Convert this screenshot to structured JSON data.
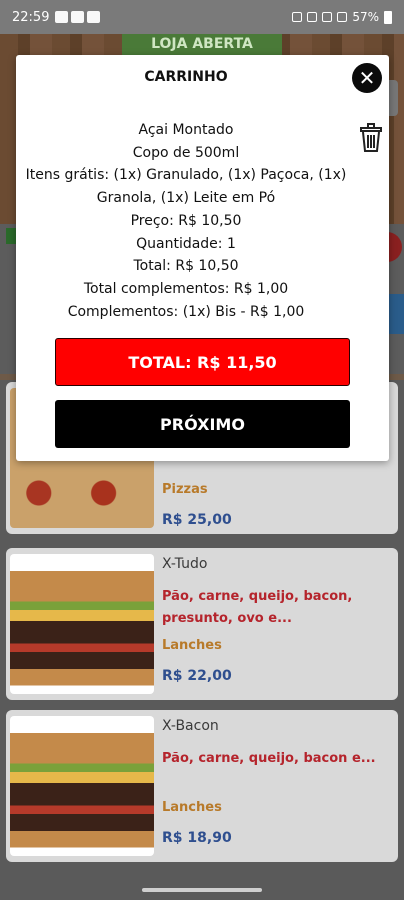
{
  "status_bar": {
    "time": "22:59",
    "battery": "57%"
  },
  "store": {
    "status_label": "LOJA ABERTA"
  },
  "cart": {
    "title": "CARRINHO",
    "close_icon": "close-icon",
    "trash_icon": "trash-icon",
    "item_name": "Açai Montado",
    "item_size": "Copo de 500ml",
    "free_items_line1": "Itens grátis: (1x) Granulado, (1x) Paçoca, (1x)",
    "free_items_line2": "Granola, (1x) Leite em Pó",
    "price": "Preço: R$ 10,50",
    "quantity": "Quantidade: 1",
    "total": "Total: R$ 10,50",
    "total_complements": "Total complementos: R$ 1,00",
    "complements": "Complementos: (1x) Bis - R$ 1,00",
    "total_button": "TOTAL: R$ 11,50",
    "next_button": "PRÓXIMO"
  },
  "products": [
    {
      "name": "",
      "description": "",
      "category": "Pizzas",
      "price": "R$ 25,00"
    },
    {
      "name": "X-Tudo",
      "description": "Pão, carne, queijo, bacon, presunto, ovo e...",
      "category": "Lanches",
      "price": "R$ 22,00"
    },
    {
      "name": "X-Bacon",
      "description": "Pão, carne, queijo, bacon e...",
      "category": "Lanches",
      "price": "R$ 18,90"
    }
  ],
  "colors": {
    "total_button": "#ff0000",
    "next_button": "#000000",
    "description": "#b5242c",
    "category": "#b87a2a",
    "price": "#2f4f8f"
  }
}
